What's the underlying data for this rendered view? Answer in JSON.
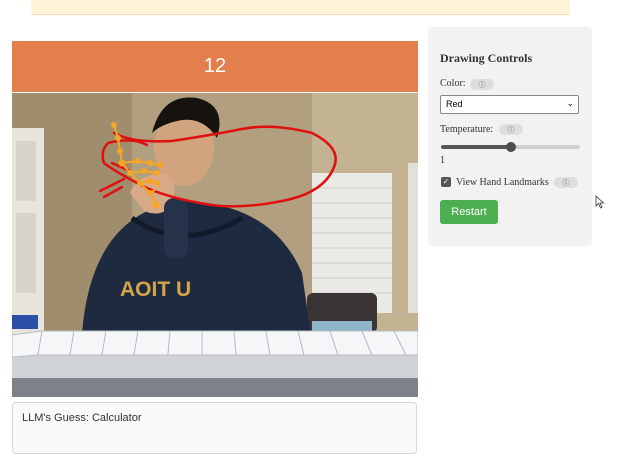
{
  "timer": {
    "value": "12"
  },
  "result": {
    "text": "LLM's Guess: Calculator"
  },
  "controls": {
    "title": "Drawing Controls",
    "color_label": "Color:",
    "color_selected": "Red",
    "temperature_label": "Temperature:",
    "temperature_value": "1",
    "temperature_fraction": 0.5,
    "landmarks_label": "View Hand Landmarks",
    "landmarks_checked": true,
    "info_icon_text": "ⓘ",
    "restart_label": "Restart"
  },
  "colors": {
    "timer_bg": "#e37f4c",
    "restart_bg": "#4caf50",
    "stroke": "#e01010",
    "landmark": "#f5a623"
  },
  "camera_text": {
    "shirt": "AOIT  U"
  }
}
